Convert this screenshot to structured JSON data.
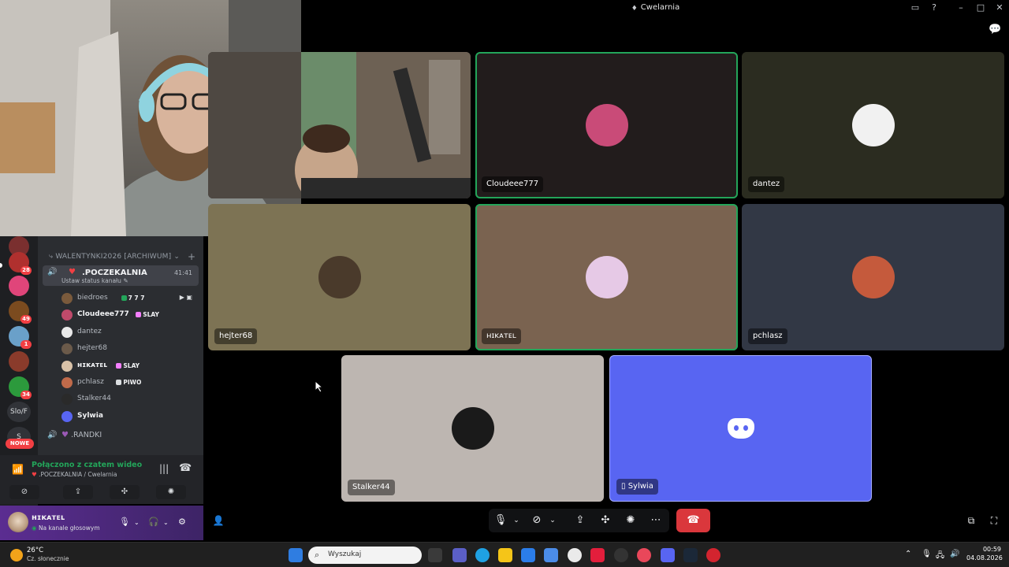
{
  "window": {
    "title": "Cwelarnia"
  },
  "sidebar": {
    "category": "WALENTYNKI2026 [ARCHIWUM]",
    "voice_channel": {
      "name": ".POCZEKALNIA",
      "status": "Ustaw status kanału",
      "timer": "41:41"
    },
    "members": [
      {
        "name": "biedroes",
        "tag": "7 7 7",
        "tag_color": "#23a55a",
        "avatar_color": "#7a5a3c",
        "highlight": false,
        "live": true
      },
      {
        "name": "Cloudeee777",
        "tag": "SLAY",
        "tag_color": "#f47fff",
        "avatar_color": "#c04a6b",
        "highlight": true,
        "live": false
      },
      {
        "name": "dantez",
        "tag": "",
        "tag_color": "",
        "avatar_color": "#e9e9e9",
        "highlight": false,
        "live": false
      },
      {
        "name": "hejter68",
        "tag": "",
        "tag_color": "",
        "avatar_color": "#6b5a4a",
        "highlight": false,
        "live": false
      },
      {
        "name": "ʜɪᴋᴀᴛᴇʟ",
        "tag": "SLAY",
        "tag_color": "#f47fff",
        "avatar_color": "#d9c2a8",
        "highlight": true,
        "live": false
      },
      {
        "name": "pchlasz",
        "tag": "PIWO",
        "tag_color": "#dbdee1",
        "avatar_color": "#c06a4a",
        "highlight": false,
        "live": false
      },
      {
        "name": "Stalker44",
        "tag": "",
        "tag_color": "",
        "avatar_color": "#2a2a2a",
        "highlight": false,
        "live": false
      },
      {
        "name": "Sylwia",
        "tag": "",
        "tag_color": "",
        "avatar_color": "#5865f2",
        "highlight": true,
        "live": false
      }
    ],
    "second_channel": ".RANDKI"
  },
  "rail": {
    "badges": [
      "28",
      "49",
      "1",
      "34"
    ],
    "text_server": "Slo/F",
    "letter_server": "S",
    "new_label": "NOWE"
  },
  "voice_panel": {
    "status": "Połączono z czatem wideo",
    "channel": ".POCZEKALNIA / Cwelarnia"
  },
  "user_panel": {
    "username": "ʜɪᴋᴀᴛᴇʟ",
    "status": "Na kanale głosowym"
  },
  "tiles": [
    {
      "name": "",
      "kind": "camera"
    },
    {
      "name": "Cloudeee777",
      "kind": "avatar",
      "bg": "#221c1c",
      "speaking": true
    },
    {
      "name": "dantez",
      "kind": "avatar",
      "bg": "#2b2c20",
      "speaking": false
    },
    {
      "name": "hejter68",
      "kind": "avatar",
      "bg": "#7d7354",
      "speaking": false
    },
    {
      "name": "ʜɪᴋᴀᴛᴇʟ",
      "kind": "avatar",
      "bg": "#7a6350",
      "speaking": true
    },
    {
      "name": "pchlasz",
      "kind": "avatar",
      "bg": "#323845",
      "speaking": false
    },
    {
      "name": "Stalker44",
      "kind": "avatar",
      "bg": "#bdb6b1",
      "speaking": false
    },
    {
      "name": "Sylwia",
      "kind": "discord",
      "bg": "#5865f2",
      "speaking": false
    }
  ],
  "taskbar": {
    "weather_temp": "26°C",
    "weather_desc": "Cz. słonecznie",
    "search_placeholder": "Wyszukaj",
    "time": "00:59",
    "date": "04.08.2026"
  },
  "icons": {
    "colors": {
      "green": "#23a55a",
      "red": "#da373c",
      "blurple": "#5865f2"
    }
  }
}
